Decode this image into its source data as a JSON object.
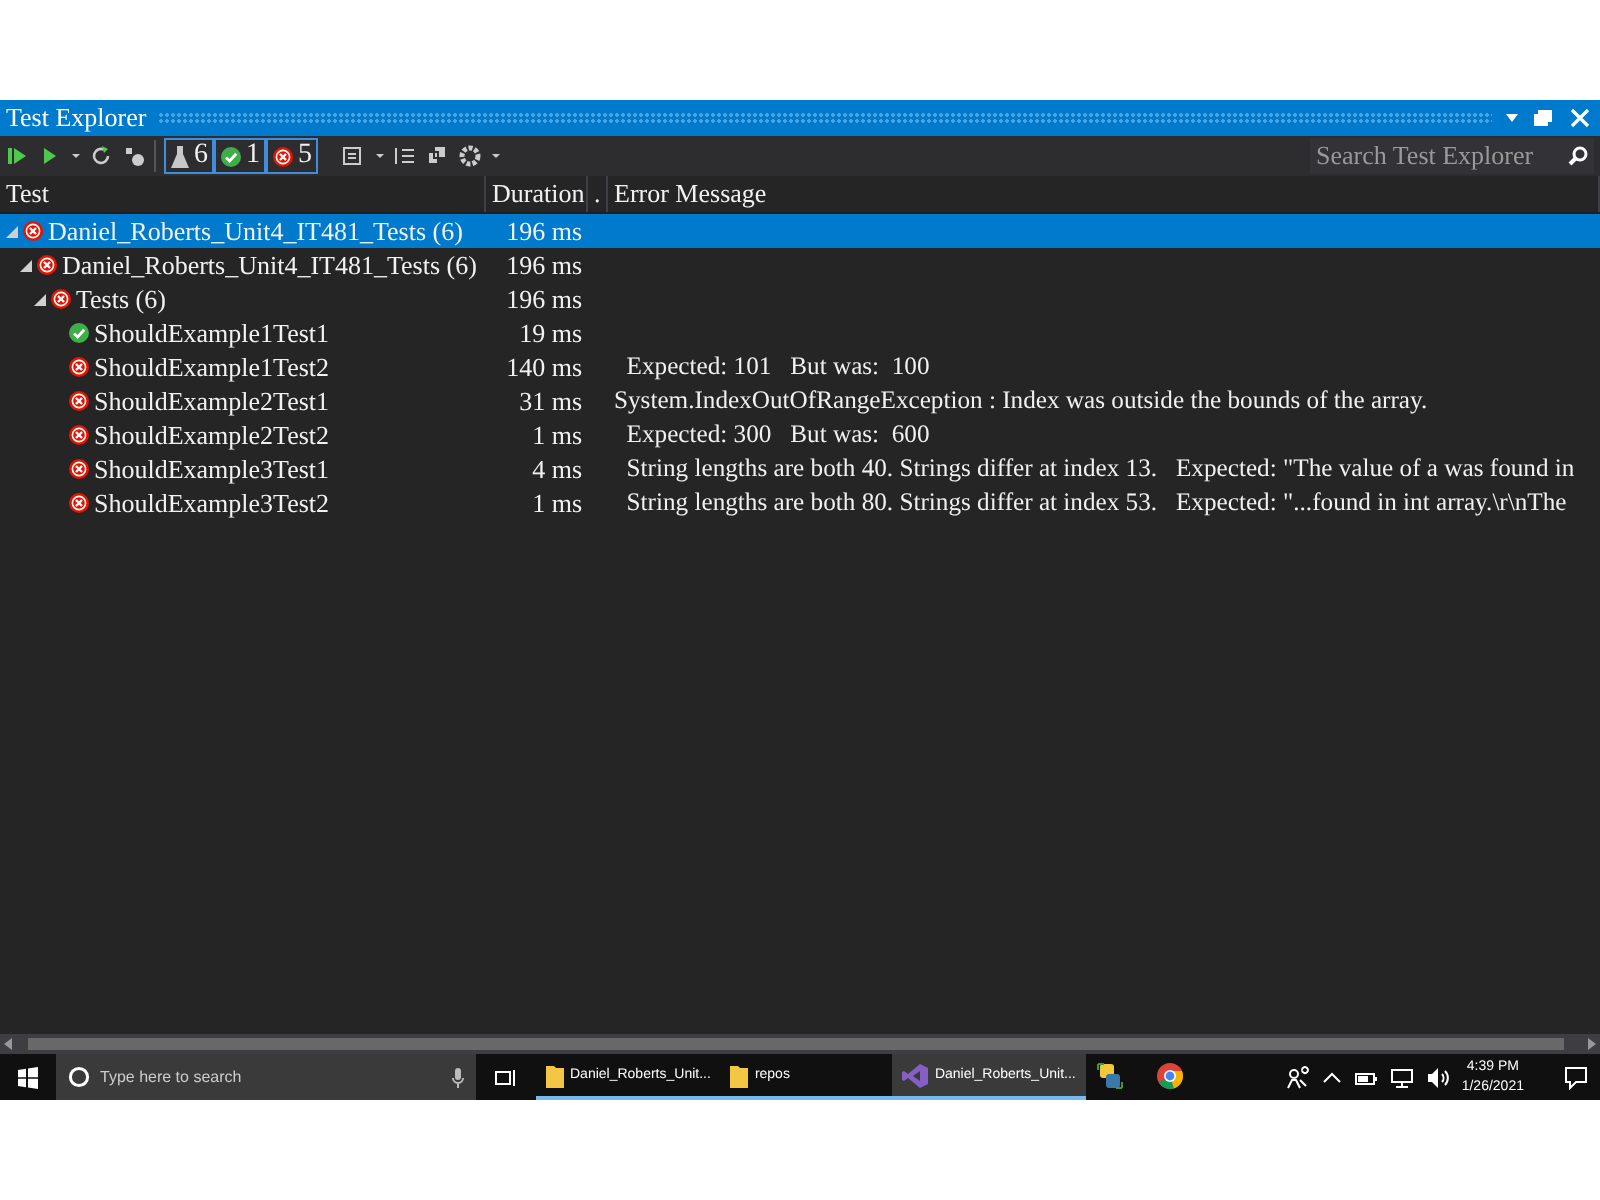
{
  "window": {
    "title": "Test Explorer"
  },
  "toolbar": {
    "counters": [
      {
        "kind": "total",
        "count": "6"
      },
      {
        "kind": "passed",
        "count": "1"
      },
      {
        "kind": "failed",
        "count": "5"
      }
    ],
    "search": {
      "placeholder": "Search Test Explorer"
    }
  },
  "table": {
    "columns": [
      "Test",
      "Duration",
      ".",
      "Error Message"
    ],
    "rows": [
      {
        "name": "Daniel_Roberts_Unit4_IT481_Tests (6)",
        "duration": "196 ms",
        "kind": "failed",
        "selected": true,
        "expanded": true,
        "children": [
          {
            "name": "Daniel_Roberts_Unit4_IT481_Tests (6)",
            "duration": "196 ms",
            "kind": "failed",
            "selected": false,
            "expanded": true,
            "children": [
              {
                "name": "Tests (6)",
                "duration": "196 ms",
                "kind": "failed",
                "selected": false,
                "expanded": true,
                "children": [
                  {
                    "name": "ShouldExample1Test1",
                    "duration": "19 ms",
                    "kind": "passed",
                    "selected": false
                  },
                  {
                    "name": "ShouldExample1Test2",
                    "duration": "140 ms",
                    "error": "  Expected: 101   But was:  100",
                    "kind": "failed",
                    "selected": false
                  },
                  {
                    "name": "ShouldExample2Test1",
                    "duration": "31 ms",
                    "error": "System.IndexOutOfRangeException : Index was outside the bounds of the array.",
                    "kind": "failed",
                    "selected": false
                  },
                  {
                    "name": "ShouldExample2Test2",
                    "duration": "1 ms",
                    "error": "  Expected: 300   But was:  600",
                    "kind": "failed",
                    "selected": false
                  },
                  {
                    "name": "ShouldExample3Test1",
                    "duration": "4 ms",
                    "error": "  String lengths are both 40. Strings differ at index 13.   Expected: \"The value of a was found in",
                    "kind": "failed",
                    "selected": false
                  },
                  {
                    "name": "ShouldExample3Test2",
                    "duration": "1 ms",
                    "error": "  String lengths are both 80. Strings differ at index 53.   Expected: \"...found in int array.\\r\\nThe",
                    "kind": "failed",
                    "selected": false
                  }
                ]
              }
            ]
          }
        ]
      }
    ]
  },
  "taskbar": {
    "search": {
      "placeholder": "Type here to search"
    },
    "apps": [
      {
        "kind": "folder",
        "label": "Daniel_Roberts_Unit...",
        "selected": false
      },
      {
        "kind": "folder",
        "label": "repos",
        "selected": false
      },
      {
        "kind": "studio",
        "label": "Daniel_Roberts_Unit...",
        "selected": true
      },
      {
        "kind": "python",
        "selected": false
      },
      {
        "kind": "browser",
        "selected": false
      }
    ],
    "time": "4:39 PM",
    "date": "1/26/2021"
  }
}
